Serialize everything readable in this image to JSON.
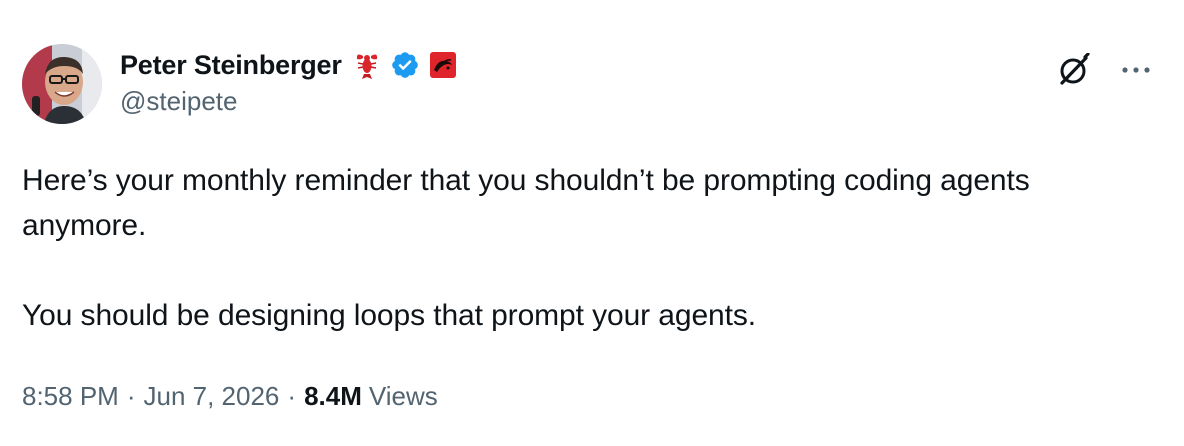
{
  "author": {
    "display_name": "Peter Steinberger",
    "handle": "@steipete",
    "verified": true,
    "badges": [
      "lobster-emoji-badge",
      "verified-badge-icon",
      "affiliate-badge-icon"
    ]
  },
  "actions": {
    "grok_icon": "grok-icon",
    "more_icon": "more-options-icon"
  },
  "tweet": {
    "paragraphs": [
      "Here’s your monthly reminder that you shouldn’t be prompting coding agents anymore.",
      "You should be designing loops that prompt your agents."
    ]
  },
  "meta": {
    "time": "8:58 PM",
    "separator": "·",
    "date": "Jun 7, 2026",
    "views_count": "8.4M",
    "views_label": "Views"
  },
  "colors": {
    "text_primary": "#0f1419",
    "text_secondary": "#536471",
    "verified_blue": "#1d9bf0",
    "badge_red": "#e0242b"
  }
}
